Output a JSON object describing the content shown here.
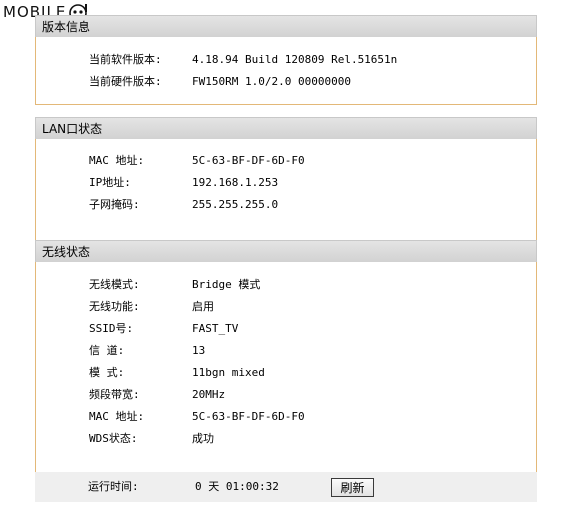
{
  "watermark": {
    "text": "MOBILE"
  },
  "version_info": {
    "title": "版本信息",
    "rows": [
      {
        "label": "当前软件版本:",
        "value": "4.18.94 Build 120809 Rel.51651n"
      },
      {
        "label": "当前硬件版本:",
        "value": "FW150RM 1.0/2.0 00000000"
      }
    ]
  },
  "lan_status": {
    "title": "LAN口状态",
    "rows": [
      {
        "label": "MAC 地址:",
        "value": "5C-63-BF-DF-6D-F0"
      },
      {
        "label": "IP地址:",
        "value": "192.168.1.253"
      },
      {
        "label": "子网掩码:",
        "value": "255.255.255.0"
      }
    ]
  },
  "wireless_status": {
    "title": "无线状态",
    "rows": [
      {
        "label": "无线模式:",
        "value": "Bridge 模式"
      },
      {
        "label": "无线功能:",
        "value": "启用"
      },
      {
        "label": "SSID号:",
        "value": "FAST_TV"
      },
      {
        "label": "信 道:",
        "value": "13"
      },
      {
        "label": "模 式:",
        "value": "11bgn mixed"
      },
      {
        "label": "频段带宽:",
        "value": "20MHz"
      },
      {
        "label": "MAC 地址:",
        "value": "5C-63-BF-DF-6D-F0"
      },
      {
        "label": "WDS状态:",
        "value": "成功"
      }
    ]
  },
  "uptime": {
    "label": "运行时间:",
    "value": "0 天 01:00:32",
    "refresh_label": "刷新"
  }
}
